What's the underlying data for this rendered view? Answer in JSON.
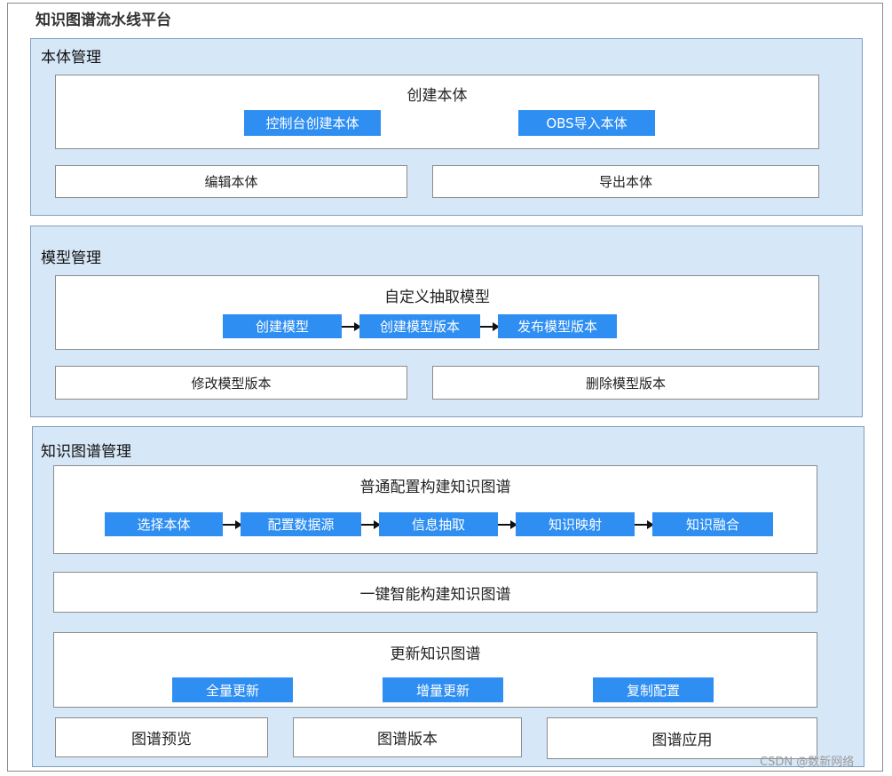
{
  "platform": {
    "title": "知识图谱流水线平台"
  },
  "ontology": {
    "title": "本体管理",
    "create": {
      "title": "创建本体",
      "buttons": [
        "控制台创建本体",
        "OBS导入本体"
      ]
    },
    "edit": "编辑本体",
    "export": "导出本体"
  },
  "model": {
    "title": "模型管理",
    "custom": {
      "title": "自定义抽取模型",
      "steps": [
        "创建模型",
        "创建模型版本",
        "发布模型版本"
      ]
    },
    "modify": "修改模型版本",
    "delete": "删除模型版本"
  },
  "kg": {
    "title": "知识图谱管理",
    "normal": {
      "title": "普通配置构建知识图谱",
      "steps": [
        "选择本体",
        "配置数据源",
        "信息抽取",
        "知识映射",
        "知识融合"
      ]
    },
    "oneclick": "一键智能构建知识图谱",
    "update": {
      "title": "更新知识图谱",
      "buttons": [
        "全量更新",
        "增量更新",
        "复制配置"
      ]
    },
    "preview": "图谱预览",
    "version": "图谱版本",
    "application": "图谱应用"
  },
  "watermark": "CSDN @数新网络",
  "colors": {
    "section_bg": "#d6e7f8",
    "step_blue": "#2e8ef2",
    "box_bg": "#ffffff"
  }
}
